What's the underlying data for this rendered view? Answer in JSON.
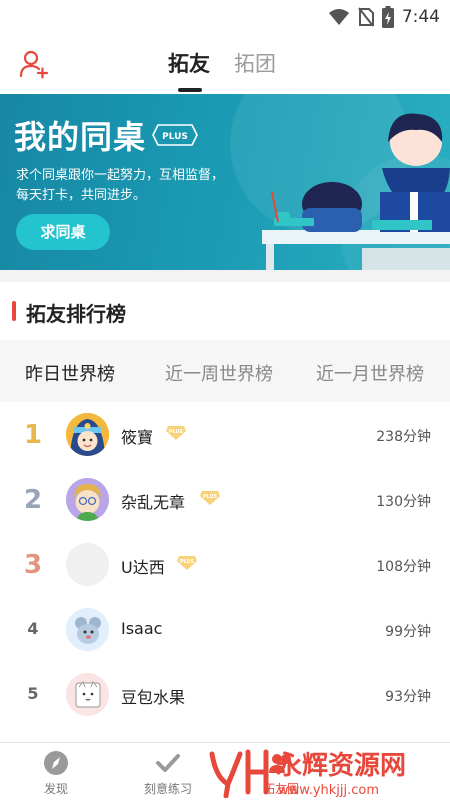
{
  "status_bar": {
    "time": "7:44"
  },
  "header": {
    "tabs": [
      {
        "label": "拓友",
        "active": true
      },
      {
        "label": "拓团",
        "active": false
      }
    ]
  },
  "banner": {
    "title": "我的同桌",
    "badge": "PLUS",
    "description": "求个同桌跟你一起努力，互相监督，每天打卡，共同进步。",
    "button_label": "求同桌"
  },
  "ranking": {
    "section_title": "拓友排行榜",
    "tabs": [
      {
        "label": "昨日世界榜",
        "active": true
      },
      {
        "label": "近一周世界榜",
        "active": false
      },
      {
        "label": "近一月世界榜",
        "active": false
      }
    ],
    "rows": [
      {
        "rank": "1",
        "name": "筱寶",
        "plus": true,
        "minutes": "238分钟"
      },
      {
        "rank": "2",
        "name": "杂乱无章",
        "plus": true,
        "minutes": "130分钟"
      },
      {
        "rank": "3",
        "name": "U达西",
        "plus": true,
        "minutes": "108分钟"
      },
      {
        "rank": "4",
        "name": "Isaac",
        "plus": false,
        "minutes": "99分钟"
      },
      {
        "rank": "5",
        "name": "豆包水果",
        "plus": false,
        "minutes": "93分钟"
      }
    ]
  },
  "bottom_nav": {
    "items": [
      {
        "label": "发现",
        "icon": "compass-icon",
        "active": false
      },
      {
        "label": "刻意练习",
        "icon": "check-icon",
        "active": false
      },
      {
        "label": "拓友圈",
        "icon": "friends-icon",
        "active": true
      }
    ]
  },
  "watermark": {
    "text": "永辉资源网",
    "url": "www.yhkjjj.com"
  },
  "colors": {
    "accent_red": "#e8483b",
    "banner_teal": "#1a9ab3",
    "gold": "#f3c15a"
  }
}
